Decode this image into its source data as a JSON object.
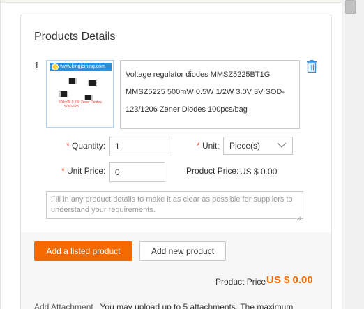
{
  "section": {
    "title": "Products Details"
  },
  "item": {
    "index": "1",
    "thumbnail": {
      "site": "www.kingjoining.com",
      "caption_line1": "500mW 0.5W Zener Diodes",
      "caption_line2": "SOD-123"
    },
    "description": "Voltage regulator diodes MMSZ5225BT1G MMSZ5225 500mW 0.5W 1/2W 3.0V 3V SOD-123/1206 Zener Diodes 100pcs/bag"
  },
  "quantity": {
    "label": "Quantity:",
    "value": "1"
  },
  "unit": {
    "label": "Unit:",
    "value": "Piece(s)"
  },
  "unit_price": {
    "label": "Unit Price:",
    "value": "0"
  },
  "product_price_inline": {
    "label": "Product Price:",
    "value": "US $ 0.00"
  },
  "details_field": {
    "placeholder": "Fill in any product details to make it as clear as possible for suppliers to understand your requirements."
  },
  "buttons": {
    "add_listed": "Add a listed product",
    "add_new": "Add new product"
  },
  "total": {
    "label": "Product Price",
    "value": "US $ 0.00"
  },
  "attachment": {
    "link": "Add Attachment",
    "text": "You may upload up to 5 attachments. The maximum"
  },
  "colors": {
    "accent": "#f56a00",
    "required": "#e04a2b",
    "trash": "#3a8fd6"
  },
  "icons": [
    "trash-icon",
    "chevron-down-icon",
    "resize-grip-icon"
  ]
}
